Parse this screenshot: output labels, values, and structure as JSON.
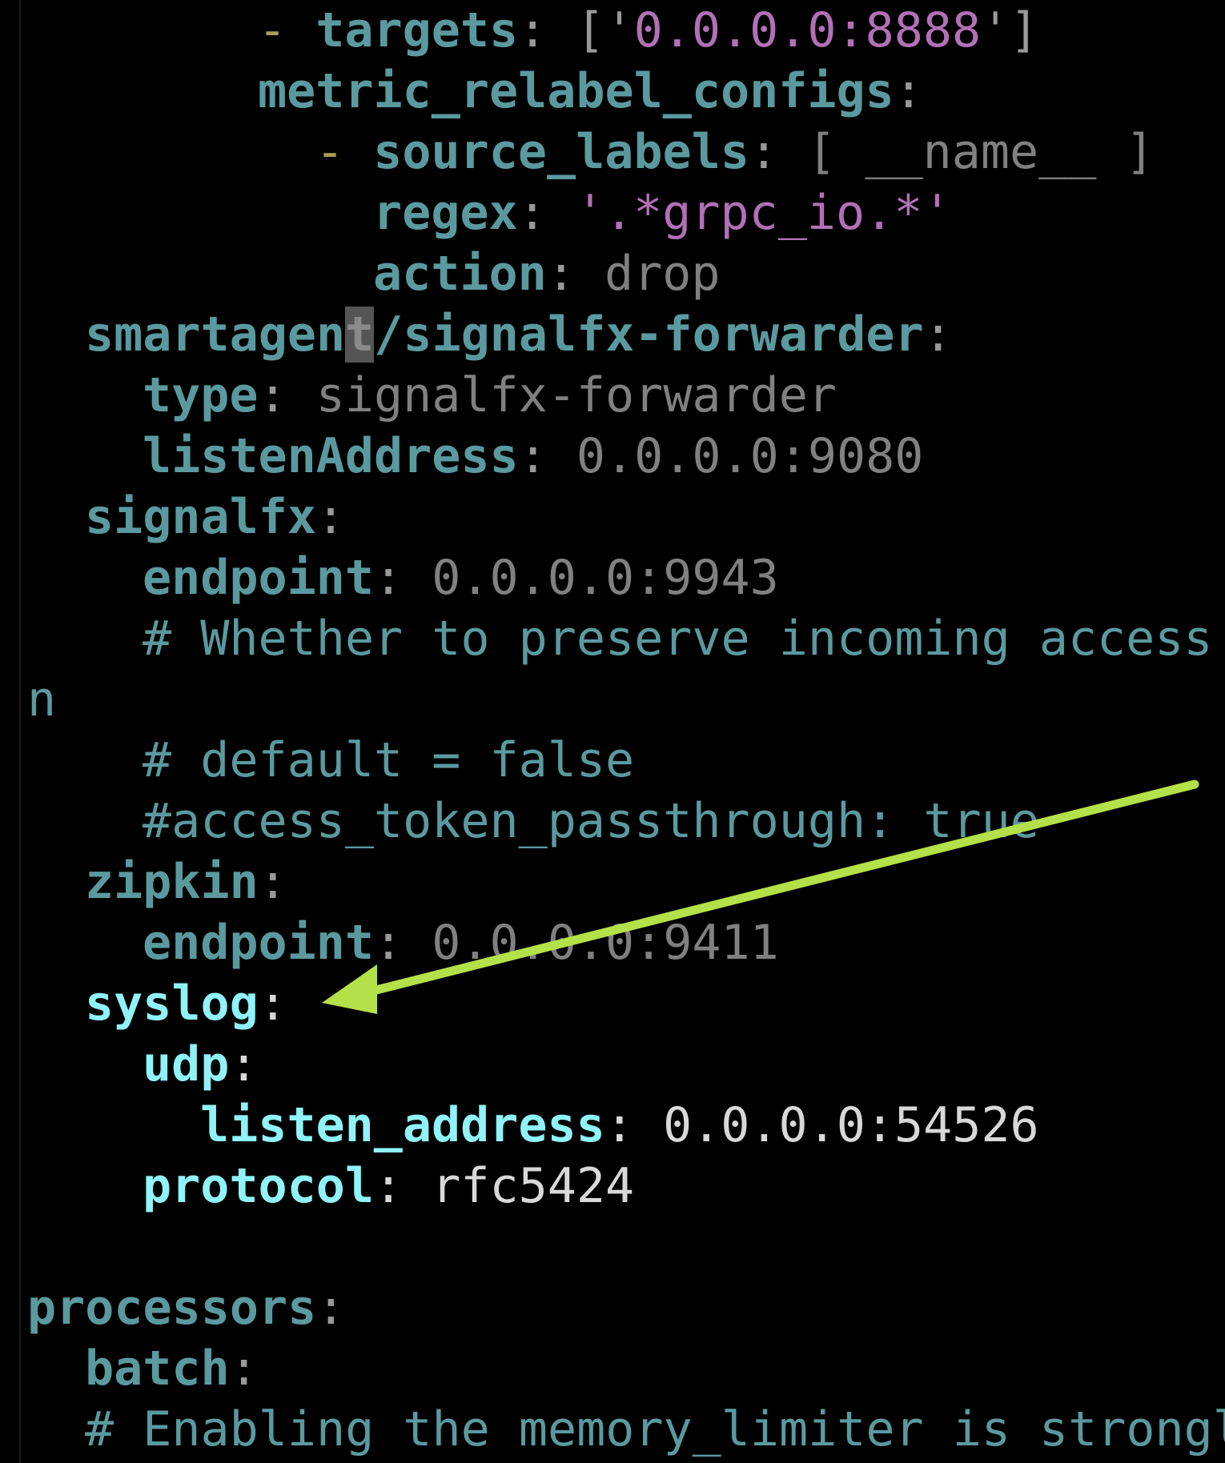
{
  "colors": {
    "background": "#000000",
    "key": "#5a9a9f",
    "key_highlight": "#8ff3f8",
    "string": "#b270b6",
    "value": "#808080",
    "dash": "#a59e59",
    "annotation_arrow": "#b4e04a"
  },
  "code": {
    "line1": {
      "dash": "- ",
      "key": "targets",
      "colon": ": ",
      "open": "['",
      "value": "0.0.0.0:8888",
      "close": "']"
    },
    "line2": {
      "key": "metric_relabel_configs",
      "colon": ":"
    },
    "line3": {
      "dash": "- ",
      "key": "source_labels",
      "colon": ": ",
      "value": "[ __name__ ]"
    },
    "line4": {
      "key": "regex",
      "colon": ": ",
      "value": "'.*grpc_io.*'"
    },
    "line5": {
      "key": "action",
      "colon": ": ",
      "value": "drop"
    },
    "line6": {
      "key_before_cursor": "smartagen",
      "cursor_char": "t",
      "key_after_cursor": "/signalfx-forwarder",
      "colon": ":"
    },
    "line7": {
      "key": "type",
      "colon": ": ",
      "value": "signalfx-forwarder"
    },
    "line8": {
      "key": "listenAddress",
      "colon": ": ",
      "value": "0.0.0.0:9080"
    },
    "line9": {
      "key": "signalfx",
      "colon": ":"
    },
    "line10": {
      "key": "endpoint",
      "colon": ": ",
      "value": "0.0.0.0:9943"
    },
    "line11": {
      "comment": "# Whether to preserve incoming access"
    },
    "line12": {
      "text": "n"
    },
    "line13": {
      "comment": "# default = false"
    },
    "line14": {
      "comment": "#access_token_passthrough: true"
    },
    "line15": {
      "key": "zipkin",
      "colon": ":"
    },
    "line16": {
      "key": "endpoint",
      "colon": ": ",
      "value": "0.0.0.0:9411"
    },
    "line17": {
      "key": "syslog",
      "colon": ":"
    },
    "line18": {
      "key": "udp",
      "colon": ":"
    },
    "line19": {
      "key": "listen_address",
      "colon": ": ",
      "value": "0.0.0.0:54526"
    },
    "line20": {
      "key": "protocol",
      "colon": ": ",
      "value": "rfc5424"
    },
    "line22": {
      "key": "processors",
      "colon": ":"
    },
    "line23": {
      "key": "batch",
      "colon": ":"
    },
    "line24": {
      "comment": "# Enabling the memory_limiter is strongl"
    }
  }
}
